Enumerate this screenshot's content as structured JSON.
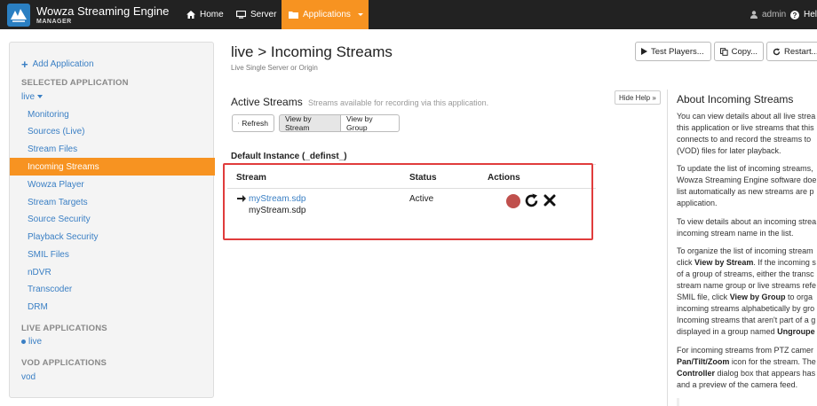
{
  "brand": {
    "title": "Wowza Streaming Engine",
    "subtitle": "MANAGER"
  },
  "nav": {
    "home": "Home",
    "server": "Server",
    "applications": "Applications",
    "admin": "admin",
    "help": "Help"
  },
  "sidebar": {
    "add_application": "Add Application",
    "selected_heading": "SELECTED APPLICATION",
    "selected_app": "live",
    "items": [
      "Monitoring",
      "Sources (Live)",
      "Stream Files",
      "Incoming Streams",
      "Wowza Player",
      "Stream Targets",
      "Source Security",
      "Playback Security",
      "SMIL Files",
      "nDVR",
      "Transcoder",
      "DRM"
    ],
    "active_item": "Incoming Streams",
    "live_heading": "LIVE APPLICATIONS",
    "live_apps": [
      "live"
    ],
    "vod_heading": "VOD APPLICATIONS",
    "vod_apps": [
      "vod"
    ]
  },
  "page": {
    "title": "live > Incoming Streams",
    "subtitle": "Live Single Server or Origin",
    "test_players": "Test Players...",
    "copy": "Copy...",
    "restart": "Restart..."
  },
  "streams": {
    "title": "Active Streams",
    "description": "Streams available for recording via this application.",
    "hide_help": "Hide Help »",
    "refresh": "Refresh",
    "view_by_stream": "View by Stream",
    "view_by_group": "View by Group",
    "instance": "Default Instance (_definst_)",
    "col_stream": "Stream",
    "col_status": "Status",
    "col_actions": "Actions",
    "rows": [
      {
        "name": "myStream.sdp",
        "source": "myStream.sdp",
        "status": "Active"
      }
    ]
  },
  "help": {
    "title": "About Incoming Streams",
    "p1": [
      "You can view details about all live strea",
      "this application or live streams that this",
      "connects to and record the streams to",
      "(VOD) files for later playback."
    ],
    "p2": [
      "To update the list of incoming streams,",
      "Wowza Streaming Engine software doe",
      "list automatically as new streams are p",
      "application."
    ],
    "p3": [
      "To view details about an incoming strea",
      "incoming stream name in the list."
    ],
    "p4_l1": "To organize the list of incoming stream",
    "p4_l2a": "click ",
    "p4_l2b": "View by Stream",
    "p4_l2c": ". If the incoming s",
    "p4_l3": "of a group of streams, either the transc",
    "p4_l4": "stream name group or live streams refe",
    "p4_l5a": "SMIL file, click ",
    "p4_l5b": "View by Group",
    "p4_l5c": " to orga",
    "p4_l6": "incoming streams alphabetically by gro",
    "p4_l7": "Incoming streams that aren't part of a g",
    "p4_l8a": "displayed in a group named ",
    "p4_l8b": "Ungroupe",
    "p5_l1": "For incoming streams from PTZ camer",
    "p5_l2": "Pan/Tilt/Zoom",
    "p5_l2b": " icon for the stream. The",
    "p5_l3": "Controller",
    "p5_l3b": " dialog box that appears has",
    "p5_l4": "and a preview of the camera feed."
  },
  "colors": {
    "accent": "#f79321",
    "link": "#3a7fc4",
    "record": "#c0504d",
    "highlight": "#e03c3c"
  }
}
